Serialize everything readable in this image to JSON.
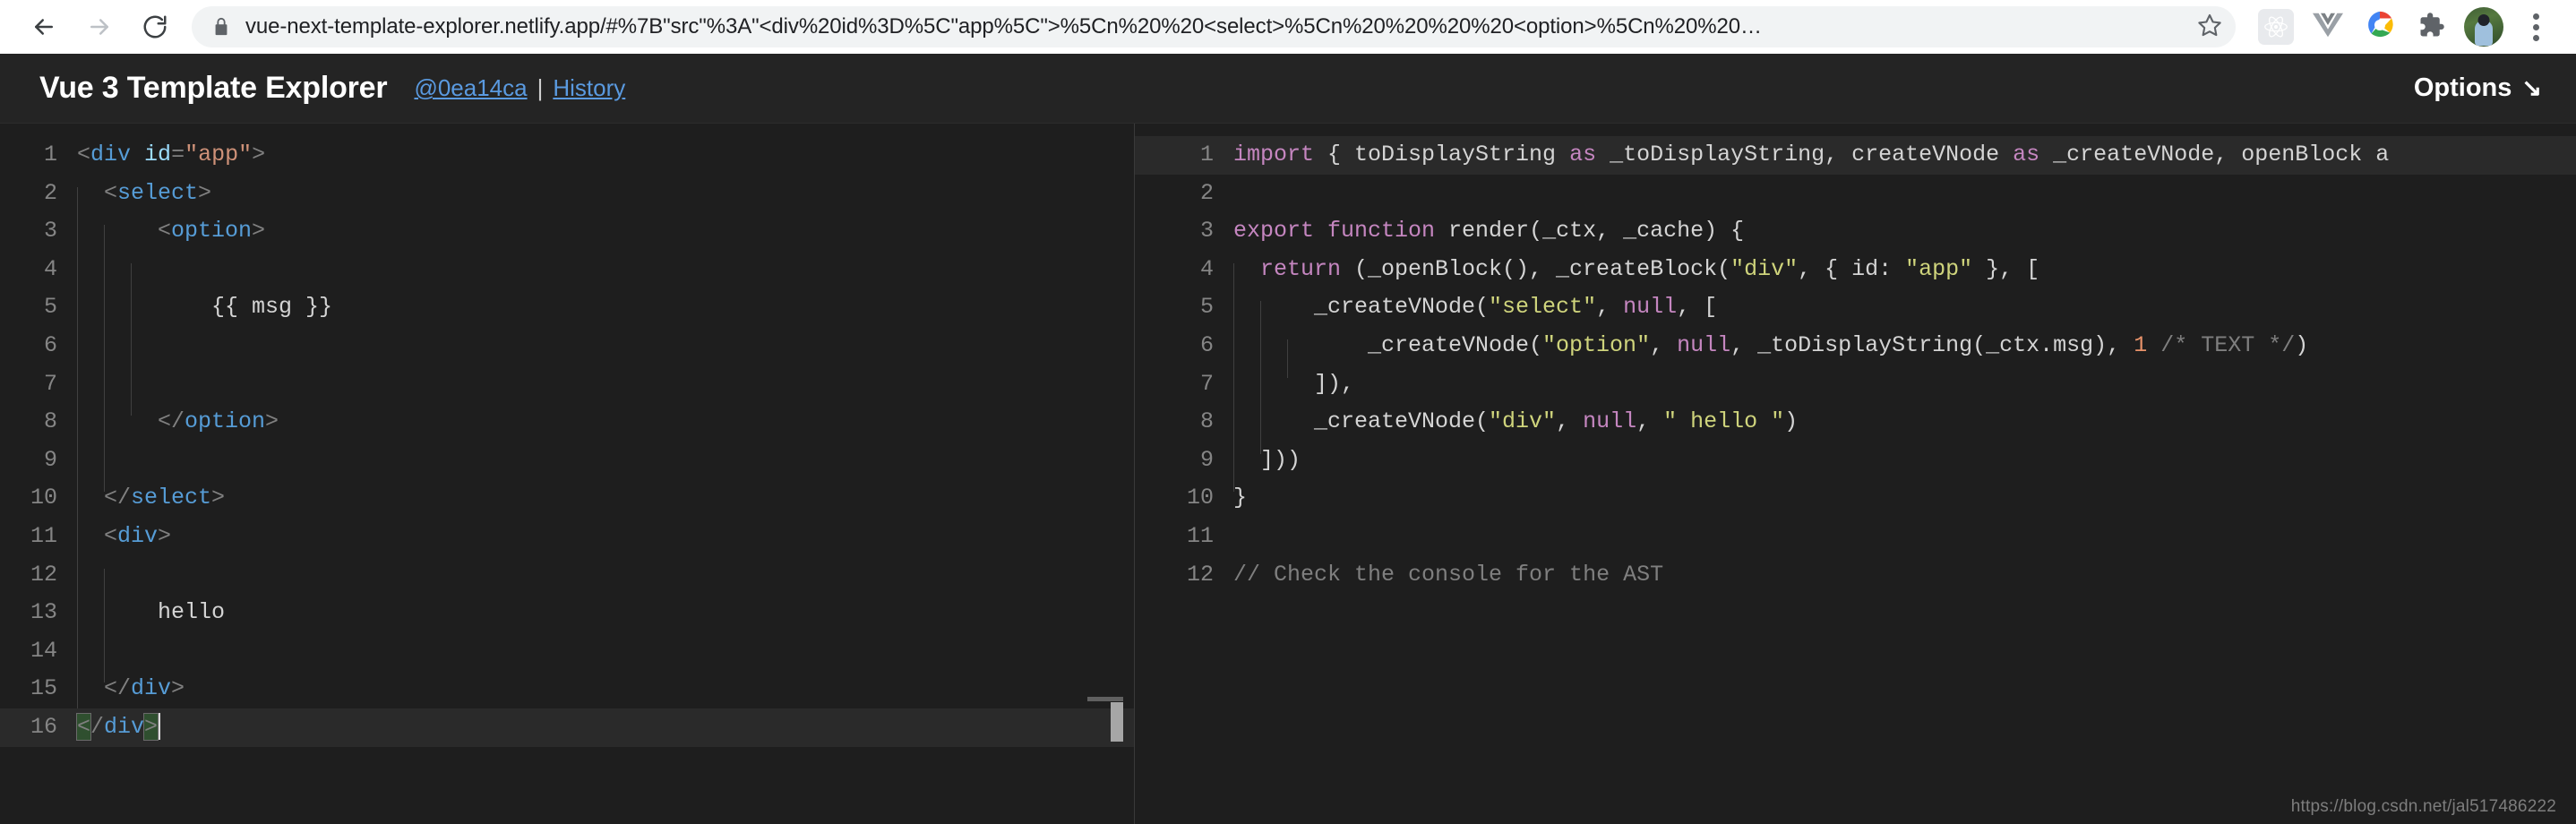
{
  "browser": {
    "back_label": "Back",
    "forward_label": "Forward",
    "reload_label": "Reload",
    "url_host": "vue-next-template-explorer.netlify.app",
    "url_path": "/#%7B\"src\"%3A\"<div%20id%3D%5C\"app%5C\">%5Cn%20%20<select>%5Cn%20%20%20%20<option>%5Cn%20%20…",
    "url_full": "vue-next-template-explorer.netlify.app/#%7B\"src\"%3A\"<div%20id%3D%5C\"app%5C\">%5Cn%20%20<select>%5Cn%20%20%20%20<option>%5Cn%20%20…",
    "lock_icon": "lock-icon",
    "star_icon": "star-icon",
    "extensions": [
      {
        "name": "react-devtools-icon",
        "label": "React Developer Tools"
      },
      {
        "name": "vue-devtools-icon",
        "label": "Vue.js devtools"
      },
      {
        "name": "google-colorwheel-icon",
        "label": "Google"
      },
      {
        "name": "puzzle-extensions-icon",
        "label": "Extensions"
      }
    ],
    "avatar_label": "Profile",
    "menu_icon": "kebab-menu-icon"
  },
  "app": {
    "title": "Vue 3 Template Explorer",
    "commit_link": "@0ea14ca",
    "separator": "|",
    "history_link": "History",
    "options_label": "Options",
    "options_arrow": "↘"
  },
  "editors": {
    "left": {
      "language": "html",
      "active_line": 16,
      "lines": [
        {
          "n": 1,
          "indent": 0,
          "tokens": [
            {
              "c": "punct",
              "t": "<"
            },
            {
              "c": "tag",
              "t": "div"
            },
            {
              "c": "plain",
              "t": " "
            },
            {
              "c": "attr",
              "t": "id"
            },
            {
              "c": "punct",
              "t": "="
            },
            {
              "c": "string",
              "t": "\"app\""
            },
            {
              "c": "punct",
              "t": ">"
            }
          ]
        },
        {
          "n": 2,
          "indent": 1,
          "tokens": [
            {
              "c": "punct",
              "t": "<"
            },
            {
              "c": "tag",
              "t": "select"
            },
            {
              "c": "punct",
              "t": ">"
            }
          ]
        },
        {
          "n": 3,
          "indent": 2,
          "tokens": [
            {
              "c": "punct",
              "t": "<"
            },
            {
              "c": "tag",
              "t": "option"
            },
            {
              "c": "punct",
              "t": ">"
            }
          ]
        },
        {
          "n": 4,
          "indent": 3,
          "tokens": []
        },
        {
          "n": 5,
          "indent": 3,
          "tokens": [
            {
              "c": "plain",
              "t": "{{ msg }}"
            }
          ]
        },
        {
          "n": 6,
          "indent": 3,
          "tokens": []
        },
        {
          "n": 7,
          "indent": 3,
          "tokens": []
        },
        {
          "n": 8,
          "indent": 2,
          "tokens": [
            {
              "c": "punct",
              "t": "</"
            },
            {
              "c": "tag",
              "t": "option"
            },
            {
              "c": "punct",
              "t": ">"
            }
          ]
        },
        {
          "n": 9,
          "indent": 2,
          "tokens": []
        },
        {
          "n": 10,
          "indent": 1,
          "tokens": [
            {
              "c": "punct",
              "t": "</"
            },
            {
              "c": "tag",
              "t": "select"
            },
            {
              "c": "punct",
              "t": ">"
            }
          ]
        },
        {
          "n": 11,
          "indent": 1,
          "tokens": [
            {
              "c": "punct",
              "t": "<"
            },
            {
              "c": "tag",
              "t": "div"
            },
            {
              "c": "punct",
              "t": ">"
            }
          ]
        },
        {
          "n": 12,
          "indent": 2,
          "tokens": []
        },
        {
          "n": 13,
          "indent": 2,
          "tokens": [
            {
              "c": "plain",
              "t": "hello"
            }
          ]
        },
        {
          "n": 14,
          "indent": 2,
          "tokens": []
        },
        {
          "n": 15,
          "indent": 1,
          "tokens": [
            {
              "c": "punct",
              "t": "</"
            },
            {
              "c": "tag",
              "t": "div"
            },
            {
              "c": "punct",
              "t": ">"
            }
          ]
        },
        {
          "n": 16,
          "indent": 0,
          "tokens": [
            {
              "c": "punct bracket-match",
              "t": "<"
            },
            {
              "c": "punct",
              "t": "/"
            },
            {
              "c": "tag",
              "t": "div"
            },
            {
              "c": "punct bracket-match",
              "t": ">"
            }
          ],
          "cursor": true
        }
      ]
    },
    "right": {
      "language": "javascript",
      "active_line": 1,
      "lines": [
        {
          "n": 1,
          "indent": 0,
          "truncated": true,
          "tokens": [
            {
              "c": "kw",
              "t": "import"
            },
            {
              "c": "id",
              "t": " { toDisplayString "
            },
            {
              "c": "kw",
              "t": "as"
            },
            {
              "c": "id",
              "t": " _toDisplayString, createVNode "
            },
            {
              "c": "kw",
              "t": "as"
            },
            {
              "c": "id",
              "t": " _createVNode, openBlock a"
            }
          ]
        },
        {
          "n": 2,
          "indent": 0,
          "tokens": []
        },
        {
          "n": 3,
          "indent": 0,
          "tokens": [
            {
              "c": "kw",
              "t": "export function"
            },
            {
              "c": "id",
              "t": " render(_ctx, _cache) {"
            }
          ]
        },
        {
          "n": 4,
          "indent": 1,
          "tokens": [
            {
              "c": "kw",
              "t": "return"
            },
            {
              "c": "id",
              "t": " (_openBlock(), _createBlock("
            },
            {
              "c": "strjs",
              "t": "\"div\""
            },
            {
              "c": "id",
              "t": ", { id: "
            },
            {
              "c": "strjs",
              "t": "\"app\""
            },
            {
              "c": "id",
              "t": " }, ["
            }
          ]
        },
        {
          "n": 5,
          "indent": 2,
          "tokens": [
            {
              "c": "id",
              "t": "_createVNode("
            },
            {
              "c": "strjs",
              "t": "\"select\""
            },
            {
              "c": "id",
              "t": ", "
            },
            {
              "c": "kw",
              "t": "null"
            },
            {
              "c": "id",
              "t": ", ["
            }
          ]
        },
        {
          "n": 6,
          "indent": 3,
          "tokens": [
            {
              "c": "id",
              "t": "_createVNode("
            },
            {
              "c": "strjs",
              "t": "\"option\""
            },
            {
              "c": "id",
              "t": ", "
            },
            {
              "c": "kw",
              "t": "null"
            },
            {
              "c": "id",
              "t": ", _toDisplayString(_ctx.msg), "
            },
            {
              "c": "num",
              "t": "1"
            },
            {
              "c": "comment",
              "t": " /* TEXT */"
            },
            {
              "c": "id",
              "t": ")"
            }
          ]
        },
        {
          "n": 7,
          "indent": 2,
          "tokens": [
            {
              "c": "id",
              "t": "]),"
            }
          ]
        },
        {
          "n": 8,
          "indent": 2,
          "tokens": [
            {
              "c": "id",
              "t": "_createVNode("
            },
            {
              "c": "strjs",
              "t": "\"div\""
            },
            {
              "c": "id",
              "t": ", "
            },
            {
              "c": "kw",
              "t": "null"
            },
            {
              "c": "id",
              "t": ", "
            },
            {
              "c": "strjs",
              "t": "\" hello \""
            },
            {
              "c": "id",
              "t": ")"
            }
          ]
        },
        {
          "n": 9,
          "indent": 1,
          "tokens": [
            {
              "c": "id",
              "t": "]))"
            }
          ]
        },
        {
          "n": 10,
          "indent": 0,
          "tokens": [
            {
              "c": "id",
              "t": "}"
            }
          ]
        },
        {
          "n": 11,
          "indent": 0,
          "tokens": []
        },
        {
          "n": 12,
          "indent": 0,
          "tokens": [
            {
              "c": "comment",
              "t": "// Check the console for the AST"
            }
          ]
        }
      ]
    }
  },
  "watermark": "https://blog.csdn.net/jal517486222",
  "colors": {
    "editor_bg": "#1e1e1e",
    "header_bg": "#242424",
    "link": "#5a9ae0",
    "gutter": "#858585",
    "tag": "#569cd6",
    "attr": "#9cdcfe",
    "string_html": "#ce9178",
    "keyword_js": "#c586c0",
    "string_js": "#cfd47c",
    "number": "#e8926a",
    "comment": "#7f7f7f",
    "active_line": "#2a2a2a"
  }
}
